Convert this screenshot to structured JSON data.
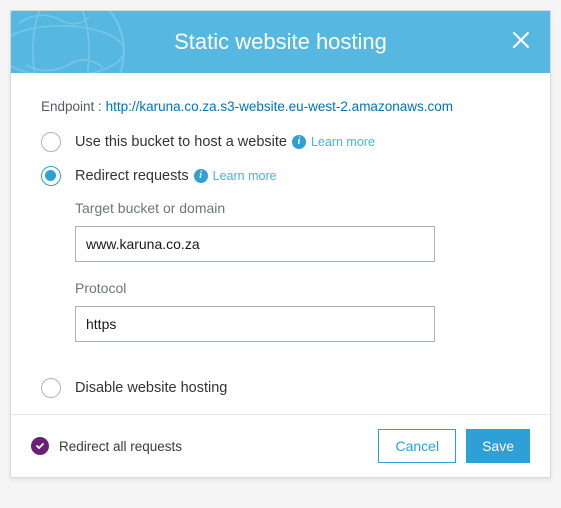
{
  "header": {
    "title": "Static website hosting"
  },
  "endpoint": {
    "label": "Endpoint :",
    "url": "http://karuna.co.za.s3-website.eu-west-2.amazonaws.com"
  },
  "options": {
    "host": {
      "label": "Use this bucket to host a website",
      "learn_more": "Learn more",
      "selected": false
    },
    "redirect": {
      "label": "Redirect requests",
      "learn_more": "Learn more",
      "selected": true,
      "target_label": "Target bucket or domain",
      "target_value": "www.karuna.co.za",
      "protocol_label": "Protocol",
      "protocol_value": "https"
    },
    "disable": {
      "label": "Disable website hosting",
      "selected": false
    }
  },
  "footer": {
    "status": "Redirect all requests",
    "cancel": "Cancel",
    "save": "Save"
  }
}
